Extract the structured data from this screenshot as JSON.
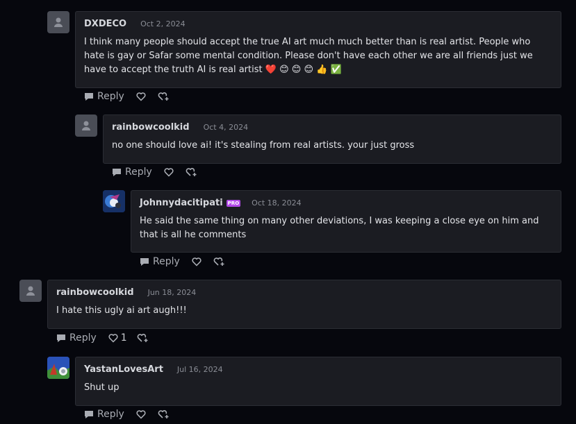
{
  "comments": [
    {
      "username": "DXDECO",
      "date": "Oct 2, 2024",
      "body_text": "I think many people should accept the true AI  art much much better than is real artist. People who hate is gay or Safar some mental condition. Please don't have each other we are all friends just we have to accept the truth AI is real artist",
      "emojis": "❤️ 😊 😊 😊 👍 ✅",
      "reply_label": "Reply"
    },
    {
      "username": "rainbowcoolkid",
      "date": "Oct 4, 2024",
      "body_text": "no one should love ai! it's stealing from real artists. your just gross",
      "reply_label": "Reply"
    },
    {
      "username": "Johnnydacitipati",
      "badge": "PRO",
      "date": "Oct 18, 2024",
      "body_text": "He said the same thing on many other deviations, I was keeping a close eye on him and that is all he comments",
      "reply_label": "Reply"
    },
    {
      "username": "rainbowcoolkid",
      "date": "Jun 18, 2024",
      "body_text": "I hate this ugly ai art augh!!!",
      "reply_label": "Reply",
      "like_count": "1"
    },
    {
      "username": "YastanLovesArt",
      "date": "Jul 16, 2024",
      "body_text": "Shut up",
      "reply_label": "Reply"
    }
  ],
  "icons": {
    "reply": "speech-bubble-icon",
    "like": "heart-icon",
    "more": "heart-plus-icon"
  },
  "colors": {
    "background": "#06070d",
    "card": "#1b1c22",
    "pro_badge": "#b249e8"
  }
}
